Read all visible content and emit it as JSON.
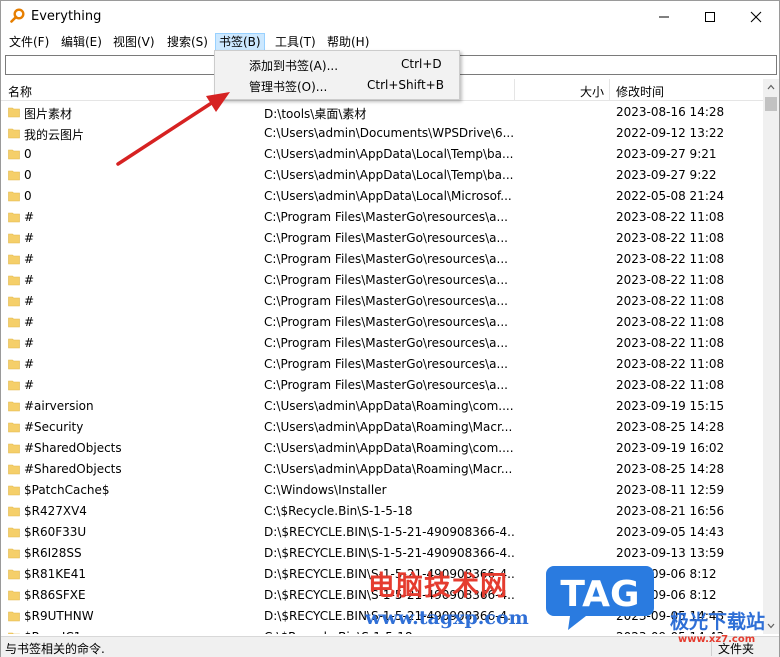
{
  "window": {
    "title": "Everything",
    "controls": [
      "minimize-icon",
      "maximize-icon",
      "close-icon"
    ]
  },
  "menu": {
    "items": [
      "文件(F)",
      "编辑(E)",
      "视图(V)",
      "搜索(S)",
      "书签(B)",
      "工具(T)",
      "帮助(H)"
    ],
    "active_index": 4
  },
  "bookmark_menu": {
    "items": [
      {
        "label": "添加到书签(A)...",
        "shortcut": "Ctrl+D"
      },
      {
        "label": "管理书签(O)...",
        "shortcut": "Ctrl+Shift+B"
      }
    ]
  },
  "search": {
    "value": "",
    "placeholder": ""
  },
  "columns": {
    "name": "名称",
    "path": "",
    "size": "大小",
    "modified": "修改时间"
  },
  "rows": [
    {
      "name": "图片素材",
      "path": "D:\\tools\\桌面\\素材",
      "size": "",
      "modified": "2023-08-16 14:28"
    },
    {
      "name": "我的云图片",
      "path": "C:\\Users\\admin\\Documents\\WPSDrive\\6...",
      "size": "",
      "modified": "2022-09-12 13:22"
    },
    {
      "name": "0",
      "path": "C:\\Users\\admin\\AppData\\Local\\Temp\\ba...",
      "size": "",
      "modified": "2023-09-27 9:21"
    },
    {
      "name": "0",
      "path": "C:\\Users\\admin\\AppData\\Local\\Temp\\ba...",
      "size": "",
      "modified": "2023-09-27 9:22"
    },
    {
      "name": "0",
      "path": "C:\\Users\\admin\\AppData\\Local\\Microsof...",
      "size": "",
      "modified": "2022-05-08 21:24"
    },
    {
      "name": "#",
      "path": "C:\\Program Files\\MasterGo\\resources\\a...",
      "size": "",
      "modified": "2023-08-22 11:08"
    },
    {
      "name": "#",
      "path": "C:\\Program Files\\MasterGo\\resources\\a...",
      "size": "",
      "modified": "2023-08-22 11:08"
    },
    {
      "name": "#",
      "path": "C:\\Program Files\\MasterGo\\resources\\a...",
      "size": "",
      "modified": "2023-08-22 11:08"
    },
    {
      "name": "#",
      "path": "C:\\Program Files\\MasterGo\\resources\\a...",
      "size": "",
      "modified": "2023-08-22 11:08"
    },
    {
      "name": "#",
      "path": "C:\\Program Files\\MasterGo\\resources\\a...",
      "size": "",
      "modified": "2023-08-22 11:08"
    },
    {
      "name": "#",
      "path": "C:\\Program Files\\MasterGo\\resources\\a...",
      "size": "",
      "modified": "2023-08-22 11:08"
    },
    {
      "name": "#",
      "path": "C:\\Program Files\\MasterGo\\resources\\a...",
      "size": "",
      "modified": "2023-08-22 11:08"
    },
    {
      "name": "#",
      "path": "C:\\Program Files\\MasterGo\\resources\\a...",
      "size": "",
      "modified": "2023-08-22 11:08"
    },
    {
      "name": "#",
      "path": "C:\\Program Files\\MasterGo\\resources\\a...",
      "size": "",
      "modified": "2023-08-22 11:08"
    },
    {
      "name": "#airversion",
      "path": "C:\\Users\\admin\\AppData\\Roaming\\com....",
      "size": "",
      "modified": "2023-09-19 15:15"
    },
    {
      "name": "#Security",
      "path": "C:\\Users\\admin\\AppData\\Roaming\\Macr...",
      "size": "",
      "modified": "2023-08-25 14:28"
    },
    {
      "name": "#SharedObjects",
      "path": "C:\\Users\\admin\\AppData\\Roaming\\com....",
      "size": "",
      "modified": "2023-09-19 16:02"
    },
    {
      "name": "#SharedObjects",
      "path": "C:\\Users\\admin\\AppData\\Roaming\\Macr...",
      "size": "",
      "modified": "2023-08-25 14:28"
    },
    {
      "name": "$PatchCache$",
      "path": "C:\\Windows\\Installer",
      "size": "",
      "modified": "2023-08-11 12:59"
    },
    {
      "name": "$R427XV4",
      "path": "C:\\$Recycle.Bin\\S-1-5-18",
      "size": "",
      "modified": "2023-08-21 16:56"
    },
    {
      "name": "$R60F33U",
      "path": "D:\\$RECYCLE.BIN\\S-1-5-21-490908366-4...",
      "size": "",
      "modified": "2023-09-05 14:43"
    },
    {
      "name": "$R6I28SS",
      "path": "D:\\$RECYCLE.BIN\\S-1-5-21-490908366-4...",
      "size": "",
      "modified": "2023-09-13 13:59"
    },
    {
      "name": "$R81KE41",
      "path": "D:\\$RECYCLE.BIN\\S-1-5-21-490908366-4...",
      "size": "",
      "modified": "2023-09-06 8:12"
    },
    {
      "name": "$R86SFXE",
      "path": "D:\\$RECYCLE.BIN\\S-1-5-21-490908366-4...",
      "size": "",
      "modified": "2023-09-06 8:12"
    },
    {
      "name": "$R9UTHNW",
      "path": "D:\\$RECYCLE.BIN\\S-1-5-21-490908366-4...",
      "size": "",
      "modified": "2023-09-05 14:43"
    },
    {
      "name": "$RaeeIC1",
      "path": "C:\\$Recycle.Bin\\S-1-5-18",
      "size": "",
      "modified": "2023-09-05 14:43"
    }
  ],
  "status": {
    "text": "与书签相关的命令.",
    "right": "文件夹"
  },
  "watermark": {
    "cn": "电脑技术网",
    "url": "www.tagxp.com",
    "tag": "TAG",
    "xz": "极光下载站",
    "xz_url": "www.xz7.com"
  },
  "colors": {
    "folder": "#f5cf6a",
    "menu_active": "#cce8ff",
    "arrow": "#d62222",
    "watermark_red": "#e53c2f",
    "watermark_blue": "#2f6fd6"
  }
}
